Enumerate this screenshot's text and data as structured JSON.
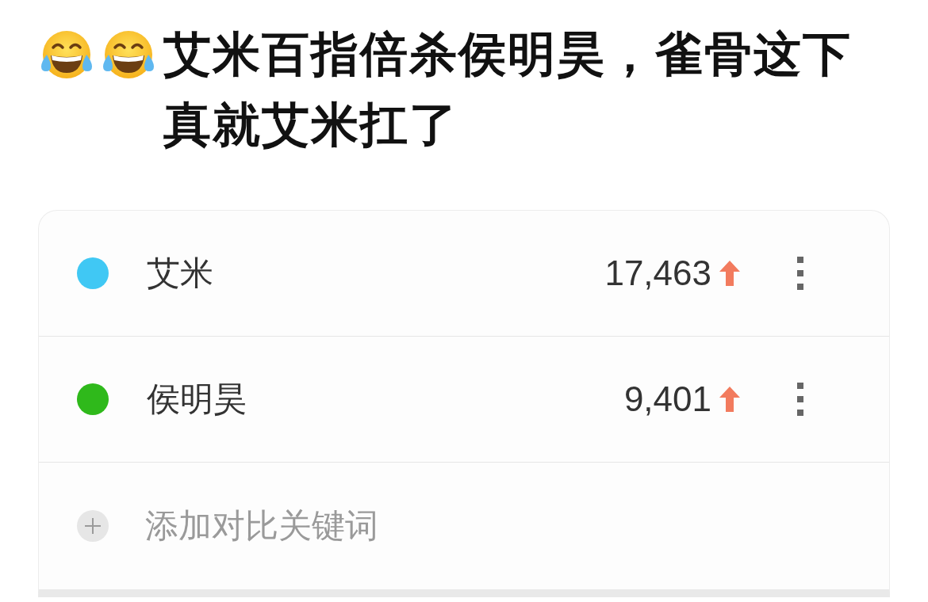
{
  "post": {
    "title": "艾米百指倍杀侯明昊，雀骨这下真就艾米扛了"
  },
  "keywords": [
    {
      "name": "艾米",
      "color": "#40c8f4",
      "count": "17,463",
      "rising": true
    },
    {
      "name": "侯明昊",
      "color": "#2fb91b",
      "count": "9,401",
      "rising": true
    }
  ],
  "add_keyword": {
    "label": "添加对比关键词"
  }
}
